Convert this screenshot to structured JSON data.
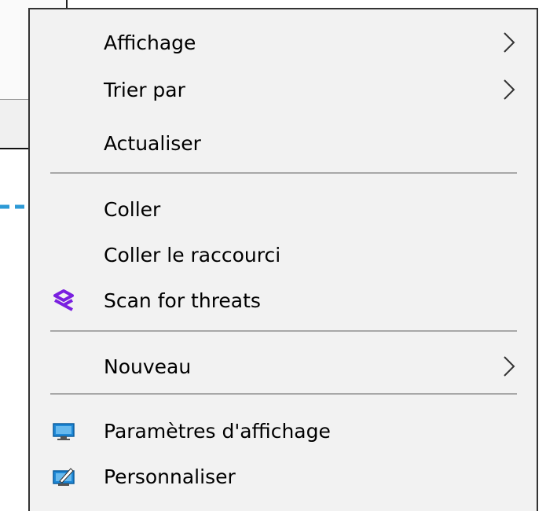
{
  "context_menu": {
    "items": [
      {
        "label": "Affichage",
        "submenu": true
      },
      {
        "label": "Trier par",
        "submenu": true
      },
      {
        "label": "Actualiser",
        "submenu": false
      },
      {
        "label": "Coller",
        "submenu": false
      },
      {
        "label": "Coller le raccourci",
        "submenu": false
      },
      {
        "label": "Scan for threats",
        "submenu": false,
        "icon": "scan-shield-icon"
      },
      {
        "label": "Nouveau",
        "submenu": true
      },
      {
        "label": "Paramètres d'affichage",
        "submenu": false,
        "icon": "monitor-icon"
      },
      {
        "label": "Personnaliser",
        "submenu": false,
        "icon": "personalize-icon"
      }
    ]
  },
  "annotation": {
    "arrow_color": "#2d9ad6",
    "points_to": "Coller"
  },
  "colors": {
    "menu_bg": "#f2f2f2",
    "accent_purple": "#7a20e0",
    "monitor_blue": "#1e88d6"
  }
}
